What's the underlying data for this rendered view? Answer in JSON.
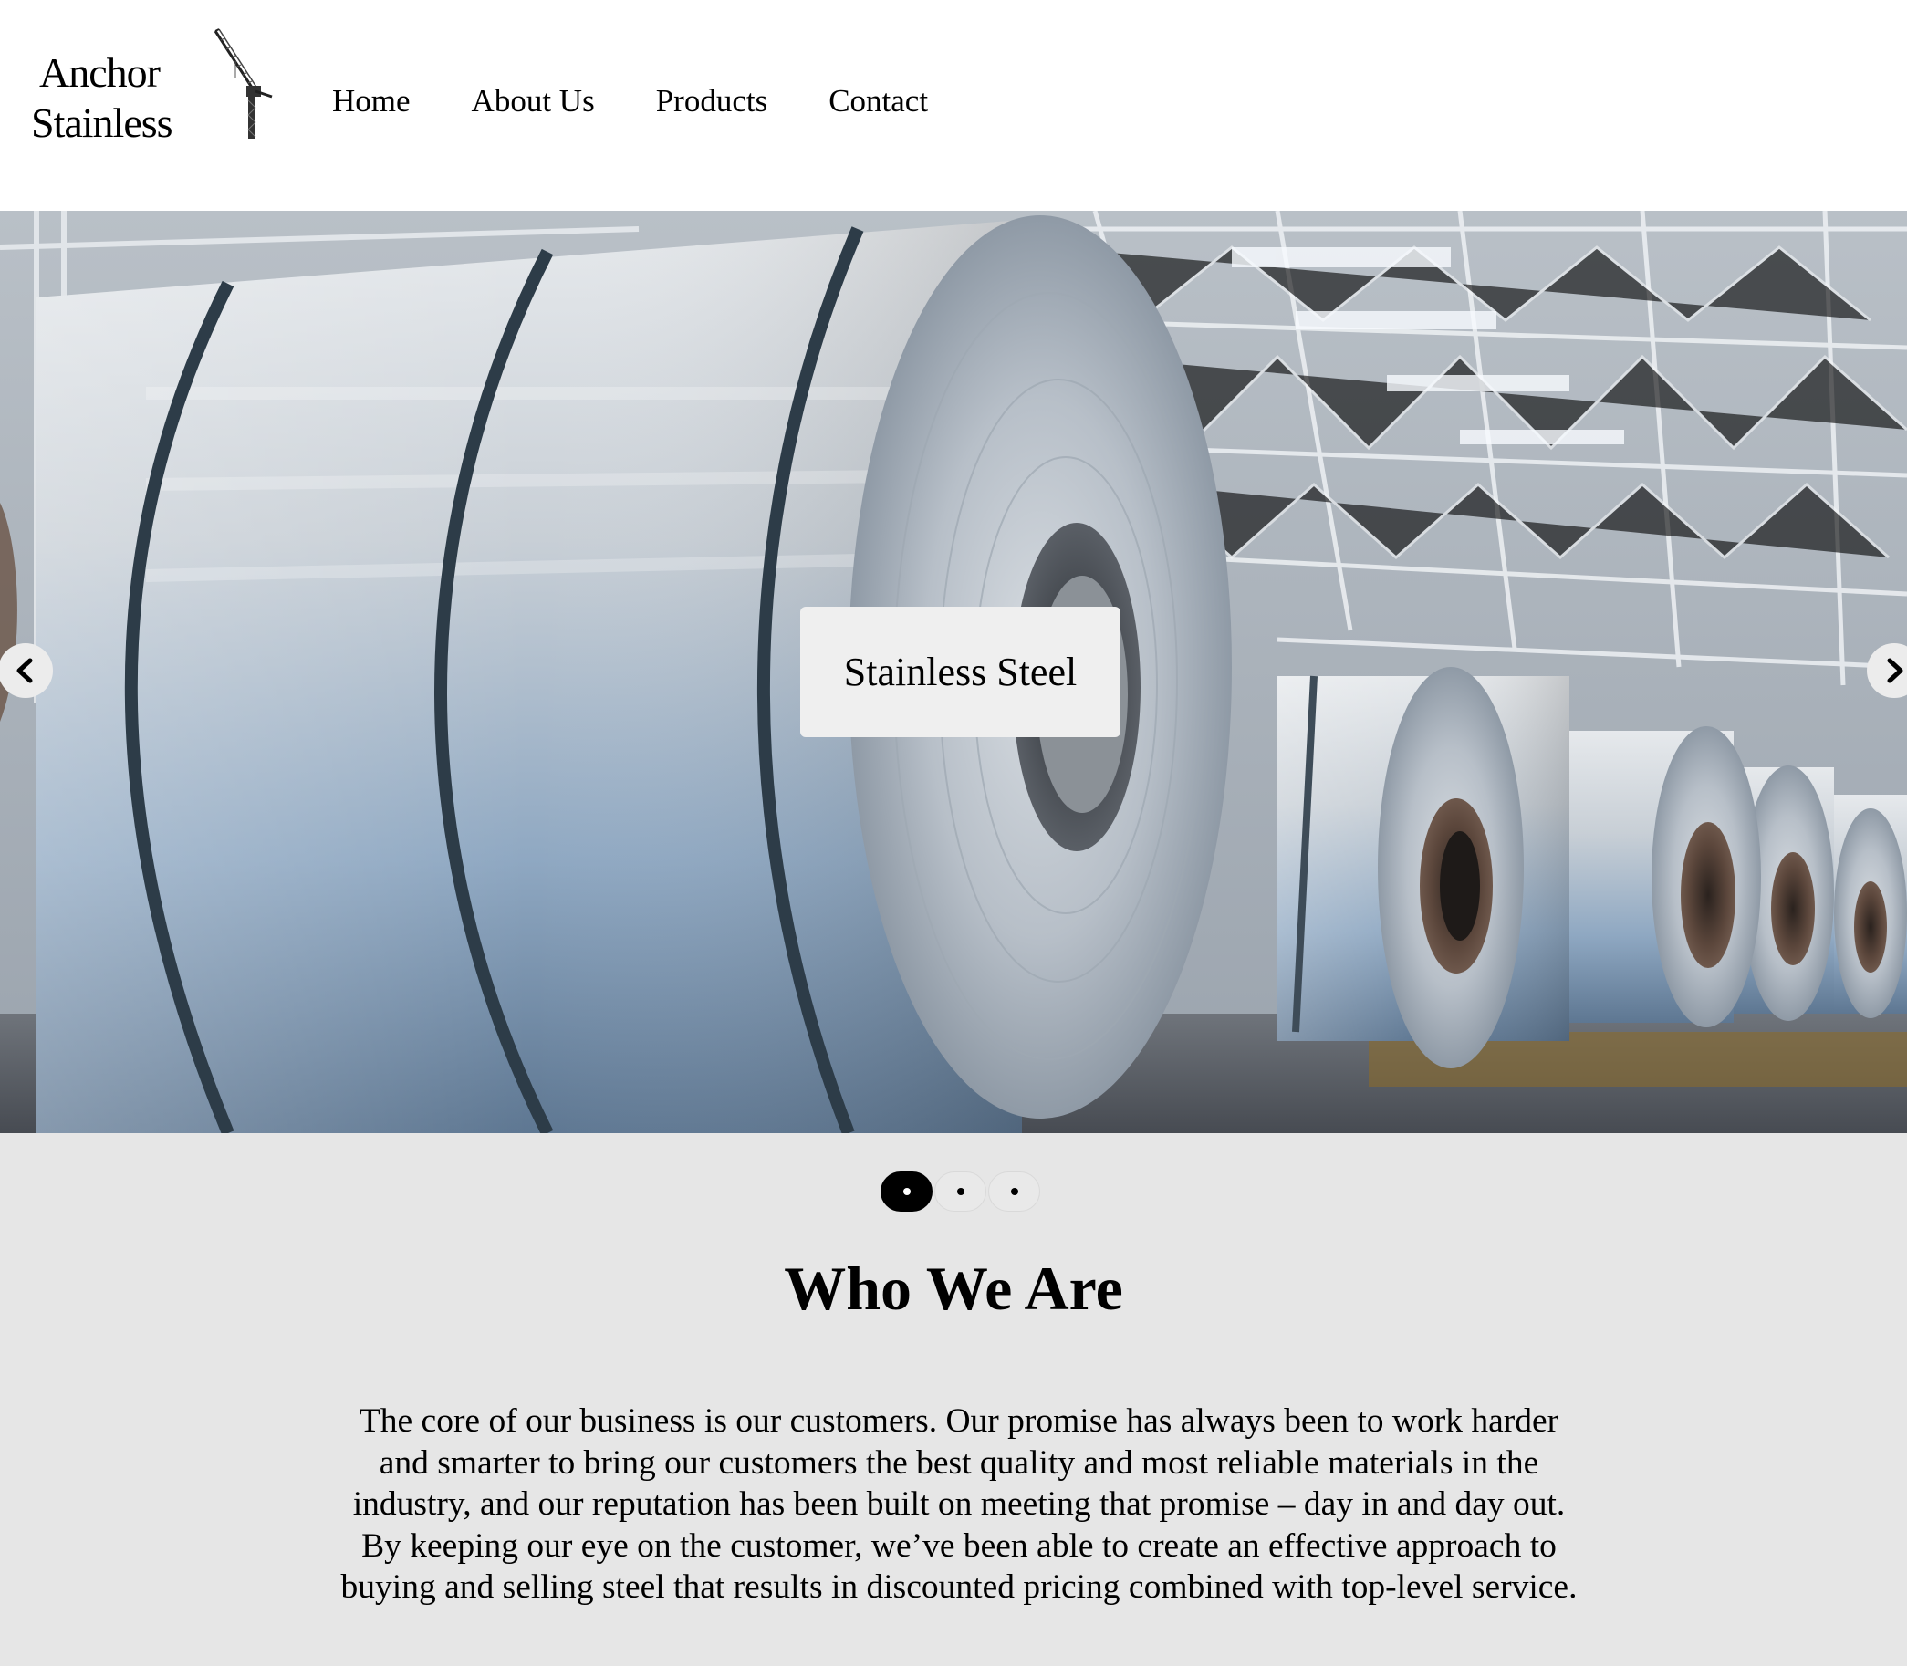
{
  "header": {
    "logo": {
      "line1": "Anchor",
      "line2": "Stainless",
      "icon": "crane-icon"
    },
    "nav": [
      {
        "label": "Home"
      },
      {
        "label": "About Us"
      },
      {
        "label": "Products"
      },
      {
        "label": "Contact"
      }
    ]
  },
  "hero": {
    "image": "steel-coils-warehouse-image",
    "caption": "Stainless Steel",
    "prev_icon": "chevron-left-icon",
    "next_icon": "chevron-right-icon",
    "slide_count": 3,
    "active_slide": 1
  },
  "about": {
    "title": "Who We Are",
    "body": "The core of our business is our customers. Our promise has always been to work harder and smarter to bring our customers the best quality and most reliable materials in the industry, and our reputation has been built on meeting that promise – day in and day out. By keeping our eye on the customer, we’ve been able to create an effective approach to buying and selling steel that results in discounted pricing combined with top-level service."
  },
  "colors": {
    "header_bg": "#ffffff",
    "page_bg": "#e6e6e6",
    "caption_bg": "#efefef",
    "text": "#000000"
  }
}
